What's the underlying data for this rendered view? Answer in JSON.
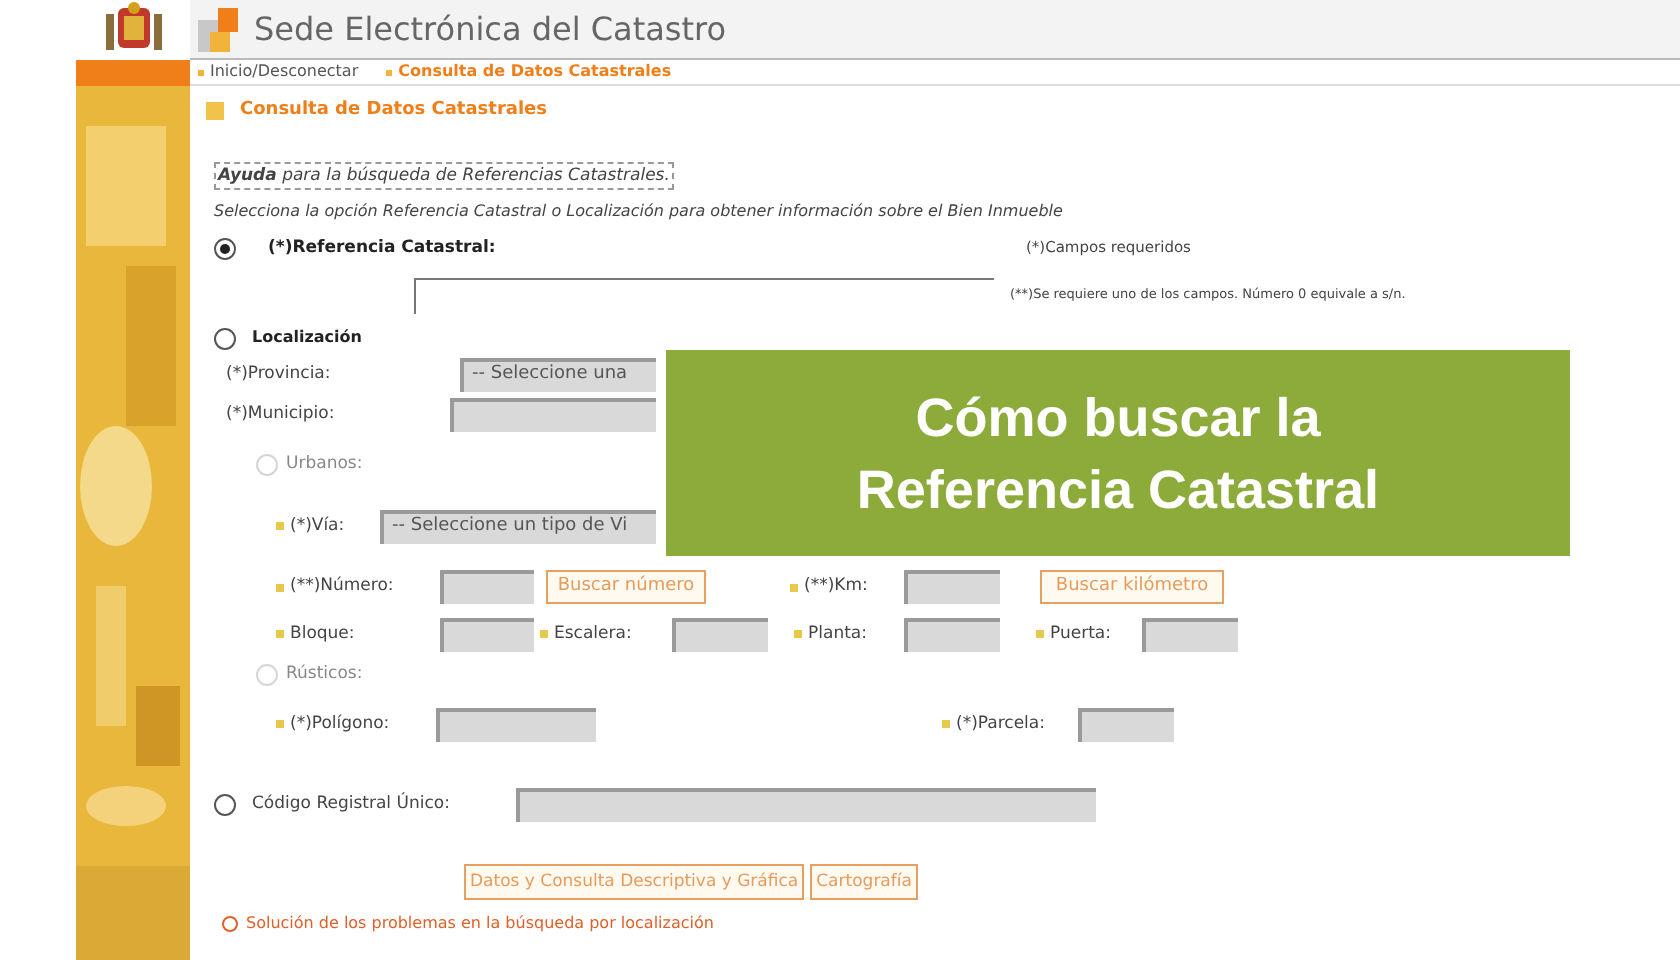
{
  "header": {
    "title": "Sede Electrónica del Catastro"
  },
  "breadcrumb": [
    {
      "label": "Inicio/Desconectar",
      "selected": false
    },
    {
      "label": "Consulta de Datos Catastrales",
      "selected": true
    }
  ],
  "heading": "Consulta de Datos Catastrales",
  "help_link": "**Ayuda** para la búsqueda de Referencias Catastrales.",
  "instruction": "Selecciona la opción Referencia Catastral o Localización para obtener información sobre el Bien Inmueble",
  "required_note": "(*)Campos requeridos",
  "either_note": "(**)Se requiere uno de los campos. Número 0 equivale a s/n.",
  "referencia": {
    "label": "(*)Referencia Catastral:",
    "selected": true
  },
  "localizacion": {
    "label": "Localización",
    "selected": false,
    "provincia": {
      "label": "(*)Provincia:",
      "value": "-- Seleccione una"
    },
    "municipio": {
      "label": "(*)Municipio:"
    },
    "urbanos": {
      "label": "Urbanos:",
      "selected": false,
      "disabled": true,
      "via": {
        "label": "(*)Vía:",
        "value": "-- Seleccione un tipo de Vi"
      },
      "numero": {
        "label": "(**)Número:",
        "button": "Buscar número"
      },
      "km": {
        "label": "(**)Km:",
        "button": "Buscar kilómetro"
      },
      "bloque": "Bloque:",
      "escalera": "Escalera:",
      "planta": "Planta:",
      "puerta": "Puerta:"
    },
    "rusticos": {
      "label": "Rústicos:",
      "selected": false,
      "disabled": true,
      "poligono": "(*)Polígono:",
      "parcela": "(*)Parcela:"
    }
  },
  "codigo": {
    "label": "Código Registral Único:",
    "selected": false
  },
  "buttons": [
    "Datos y Consulta Descriptiva y Gráfica",
    "Cartografía"
  ],
  "footer_note": "Solución de los problemas en la búsqueda por localización",
  "banner": {
    "lines": [
      "Cómo buscar la",
      "Referencia Catastral"
    ]
  }
}
